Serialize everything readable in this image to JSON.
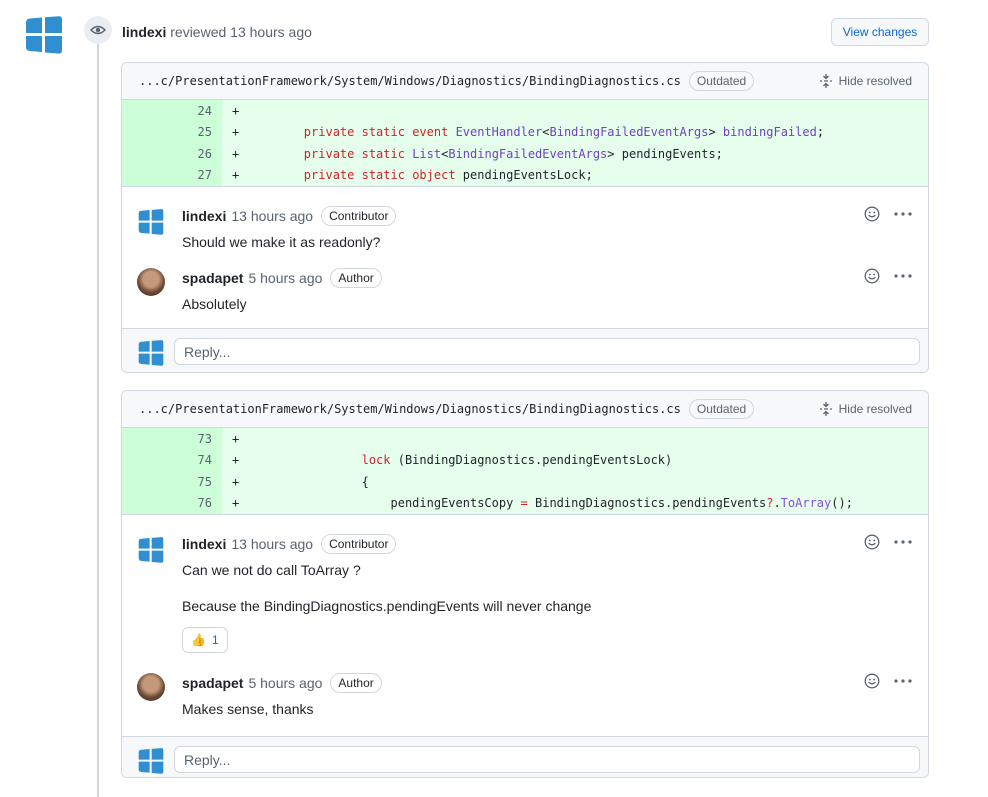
{
  "review": {
    "author": "lindexi",
    "action": "reviewed",
    "time": "13 hours ago",
    "view_changes_label": "View changes"
  },
  "threads": [
    {
      "file_path": "...c/PresentationFramework/System/Windows/Diagnostics/BindingDiagnostics.cs",
      "outdated_label": "Outdated",
      "hide_resolved_label": "Hide resolved",
      "lines": [
        {
          "num": "24",
          "sign": "+",
          "code": ""
        },
        {
          "num": "25",
          "sign": "+",
          "code": "        private static event EventHandler<BindingFailedEventArgs> bindingFailed;"
        },
        {
          "num": "26",
          "sign": "+",
          "code": "        private static List<BindingFailedEventArgs> pendingEvents;"
        },
        {
          "num": "27",
          "sign": "+",
          "code": "        private static object pendingEventsLock;"
        }
      ],
      "comments": [
        {
          "author": "lindexi",
          "time": "13 hours ago",
          "role": "Contributor",
          "body": "Should we make it as readonly?"
        },
        {
          "author": "spadapet",
          "time": "5 hours ago",
          "role": "Author",
          "body": "Absolutely"
        }
      ],
      "reply_placeholder": "Reply..."
    },
    {
      "file_path": "...c/PresentationFramework/System/Windows/Diagnostics/BindingDiagnostics.cs",
      "outdated_label": "Outdated",
      "hide_resolved_label": "Hide resolved",
      "lines": [
        {
          "num": "73",
          "sign": "+",
          "code": ""
        },
        {
          "num": "74",
          "sign": "+",
          "code": "                lock (BindingDiagnostics.pendingEventsLock)"
        },
        {
          "num": "75",
          "sign": "+",
          "code": "                {"
        },
        {
          "num": "76",
          "sign": "+",
          "code": "                    pendingEventsCopy = BindingDiagnostics.pendingEvents?.ToArray();"
        }
      ],
      "comments": [
        {
          "author": "lindexi",
          "time": "13 hours ago",
          "role": "Contributor",
          "body": "Can we not do call ToArray ?",
          "body2": "Because the BindingDiagnostics.pendingEvents will never change",
          "reaction": {
            "emoji": "👍",
            "count": "1"
          }
        },
        {
          "author": "spadapet",
          "time": "5 hours ago",
          "role": "Author",
          "body": "Makes sense, thanks"
        }
      ],
      "reply_placeholder": "Reply..."
    }
  ]
}
